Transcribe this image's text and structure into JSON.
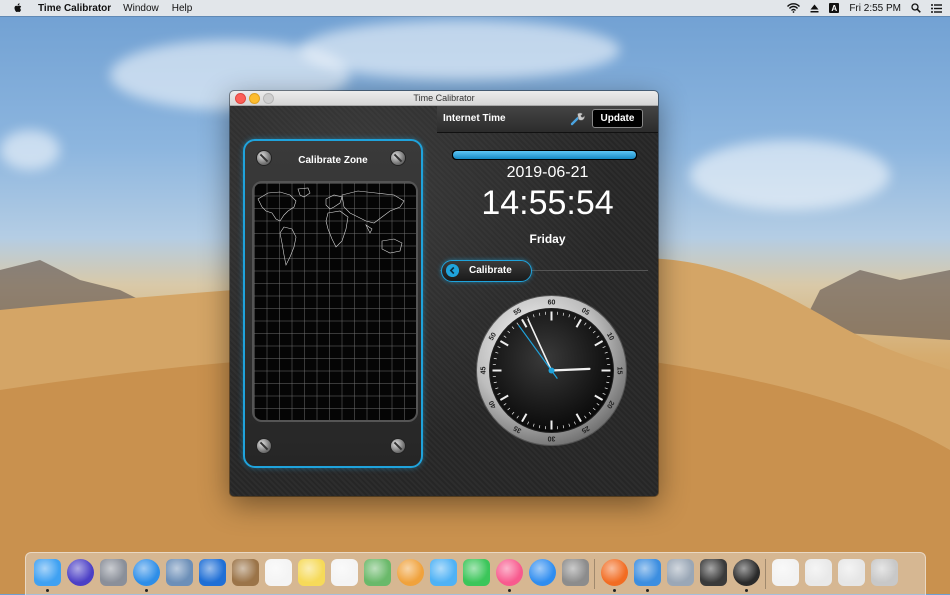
{
  "menubar": {
    "app_name": "Time Calibrator",
    "menus": [
      "Window",
      "Help"
    ],
    "input_source": "A",
    "clock": "Fri 2:55 PM"
  },
  "window": {
    "title": "Time Calibrator",
    "calibrate_zone": {
      "title": "Calibrate Zone"
    },
    "internet_time": {
      "label": "Internet Time",
      "update_label": "Update",
      "progress": 1.0,
      "date": "2019-06-21",
      "time": "14:55:54",
      "day": "Friday"
    },
    "calibrate_label": "Calibrate",
    "analog_clock": {
      "hours": 14,
      "minutes": 55,
      "seconds": 54,
      "ring_numbers": [
        "60",
        "05",
        "10",
        "15",
        "20",
        "25",
        "30",
        "35",
        "40",
        "45",
        "50",
        "55"
      ]
    }
  },
  "colors": {
    "accent": "#1fa3dc"
  },
  "dock": {
    "items": [
      {
        "name": "finder",
        "color": "#3fa1f2",
        "running": true
      },
      {
        "name": "siri",
        "color": "#4b3fc6",
        "running": false
      },
      {
        "name": "launchpad",
        "color": "#8a8f99",
        "running": false
      },
      {
        "name": "safari",
        "color": "#2e8ee8",
        "running": true
      },
      {
        "name": "preview-photo",
        "color": "#6c8fb8",
        "running": false
      },
      {
        "name": "screen-sharing",
        "color": "#1f6fd6",
        "running": false
      },
      {
        "name": "notefile",
        "color": "#9b7448",
        "running": false
      },
      {
        "name": "calendar",
        "color": "#f4f4f4",
        "running": false
      },
      {
        "name": "notes",
        "color": "#f6da59",
        "running": false
      },
      {
        "name": "reminders",
        "color": "#f4f4f4",
        "running": false
      },
      {
        "name": "maps",
        "color": "#6ab96a",
        "running": false
      },
      {
        "name": "photos",
        "color": "#f0a23c",
        "running": false
      },
      {
        "name": "messages",
        "color": "#4fb2f5",
        "running": false
      },
      {
        "name": "facetime",
        "color": "#3bc65a",
        "running": false
      },
      {
        "name": "itunes",
        "color": "#f85a8e",
        "running": true
      },
      {
        "name": "app-store",
        "color": "#2f8df0",
        "running": false
      },
      {
        "name": "system-preferences",
        "color": "#8c8c8c",
        "running": false
      },
      {
        "name": "firefox",
        "color": "#f26c22",
        "running": true
      },
      {
        "name": "xcode",
        "color": "#3c8ee0",
        "running": true
      },
      {
        "name": "disk-utility",
        "color": "#9aa7b6",
        "running": false
      },
      {
        "name": "activity-monitor",
        "color": "#3a3a3a",
        "running": false
      },
      {
        "name": "time-calibrator",
        "color": "#2a2a2a",
        "running": true
      },
      {
        "name": "document",
        "color": "#f2f2f2",
        "running": false
      },
      {
        "name": "downloads-stack",
        "color": "#e9e9e9",
        "running": false
      },
      {
        "name": "screenshots-stack",
        "color": "#e6e6e6",
        "running": false
      },
      {
        "name": "trash",
        "color": "#c8c8c8",
        "running": false
      }
    ]
  }
}
